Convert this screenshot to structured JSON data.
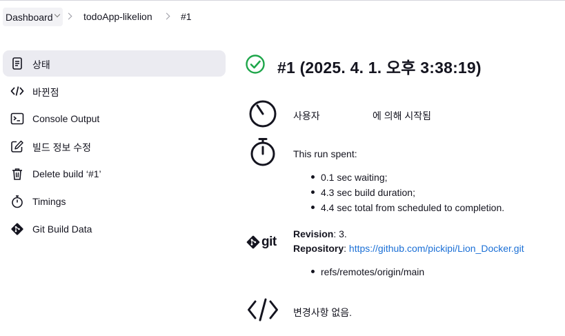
{
  "breadcrumb": {
    "dashboard": "Dashboard",
    "project": "todoApp-likelion",
    "build": "#1"
  },
  "sidebar": {
    "items": [
      {
        "label": "상태",
        "icon": "document-icon",
        "active": true
      },
      {
        "label": "바뀐점",
        "icon": "code-icon"
      },
      {
        "label": "Console Output",
        "icon": "terminal-icon"
      },
      {
        "label": "빌드 정보 수정",
        "icon": "edit-icon"
      },
      {
        "label": "Delete build ‘#1’",
        "icon": "trash-icon"
      },
      {
        "label": "Timings",
        "icon": "stopwatch-icon"
      },
      {
        "label": "Git Build Data",
        "icon": "git-icon"
      }
    ]
  },
  "build": {
    "title": "#1 (2025. 4. 1. 오후 3:38:19)",
    "status_color": "#1ea64a",
    "started_by_prefix": "사용자",
    "started_by_suffix": "에 의해 시작됨",
    "run_spent_label": "This run spent:",
    "timings": [
      "0.1 sec waiting;",
      "4.3 sec build duration;",
      "4.4 sec total from scheduled to completion."
    ],
    "git": {
      "logo_text": "git",
      "revision_label": "Revision",
      "revision_value": "3.",
      "repository_label": "Repository",
      "repository_url": "https://github.com/pickipi/Lion_Docker.git",
      "refs": [
        "refs/remotes/origin/main"
      ]
    },
    "changes_text": "변경사항 없음."
  },
  "colors": {
    "link": "#1a6fd6",
    "active_bg": "#ebebf1"
  }
}
